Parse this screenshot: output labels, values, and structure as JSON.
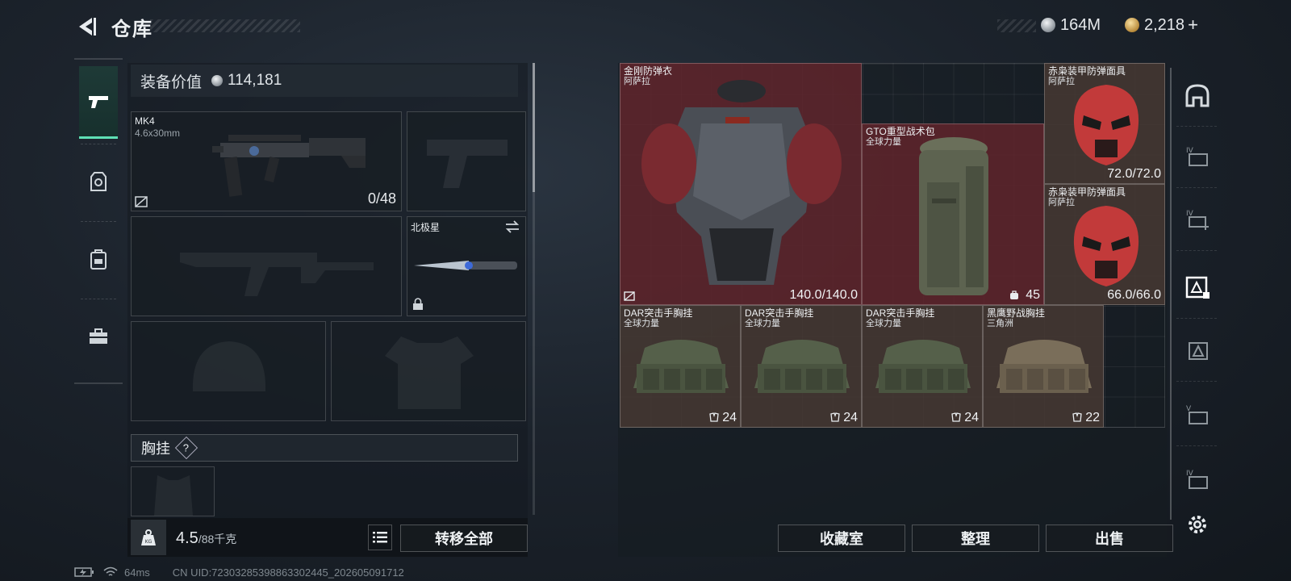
{
  "header": {
    "title": "仓库",
    "currencies": [
      {
        "icon": "silver-coin-icon",
        "value": "164M"
      },
      {
        "icon": "gold-coin-icon",
        "value": "2,218"
      }
    ],
    "add_label": "+"
  },
  "categories": [
    {
      "name": "weapon",
      "icon": "pistol-icon",
      "active": true
    },
    {
      "name": "armor",
      "icon": "armor-icon",
      "active": false
    },
    {
      "name": "backpack",
      "icon": "backpack-icon",
      "active": false
    },
    {
      "name": "toolbox",
      "icon": "toolbox-icon",
      "active": false
    }
  ],
  "equipment": {
    "value_label": "装备价值",
    "value": "114,181",
    "primary_weapon": {
      "name": "MK4",
      "caliber": "4.6x30mm",
      "ammo": "0/48"
    },
    "melee": {
      "name": "北极星"
    },
    "chest_rig_label": "胸挂",
    "chest_rig_help": "?"
  },
  "weight": {
    "current": "4.5",
    "max": "/88千克"
  },
  "buttons": {
    "transfer_all": "转移全部",
    "collection": "收藏室",
    "organize": "整理",
    "sell": "出售"
  },
  "stash_items": [
    {
      "name": "金刚防弹衣",
      "faction": "阿萨拉",
      "value": "140.0/140.0",
      "color": "#602c34"
    },
    {
      "name": "GTO重型战术包",
      "faction": "全球力量",
      "value": "45",
      "color": "#602c34"
    },
    {
      "name": "赤枭装甲防弹面具",
      "faction": "阿萨拉",
      "value": "72.0/72.0",
      "color": "#463832"
    },
    {
      "name": "赤枭装甲防弹面具",
      "faction": "阿萨拉",
      "value": "66.0/66.0",
      "color": "#463832"
    },
    {
      "name": "DAR突击手胸挂",
      "faction": "全球力量",
      "value": "24",
      "color": "#463832"
    },
    {
      "name": "DAR突击手胸挂",
      "faction": "全球力量",
      "value": "24",
      "color": "#463832"
    },
    {
      "name": "DAR突击手胸挂",
      "faction": "全球力量",
      "value": "24",
      "color": "#463832"
    },
    {
      "name": "黑鹰野战胸挂",
      "faction": "三角洲",
      "value": "22",
      "color": "#463832"
    }
  ],
  "status_bar": {
    "ping": "64ms",
    "uid": "CN UID:72303285398863302445_202605091712"
  }
}
